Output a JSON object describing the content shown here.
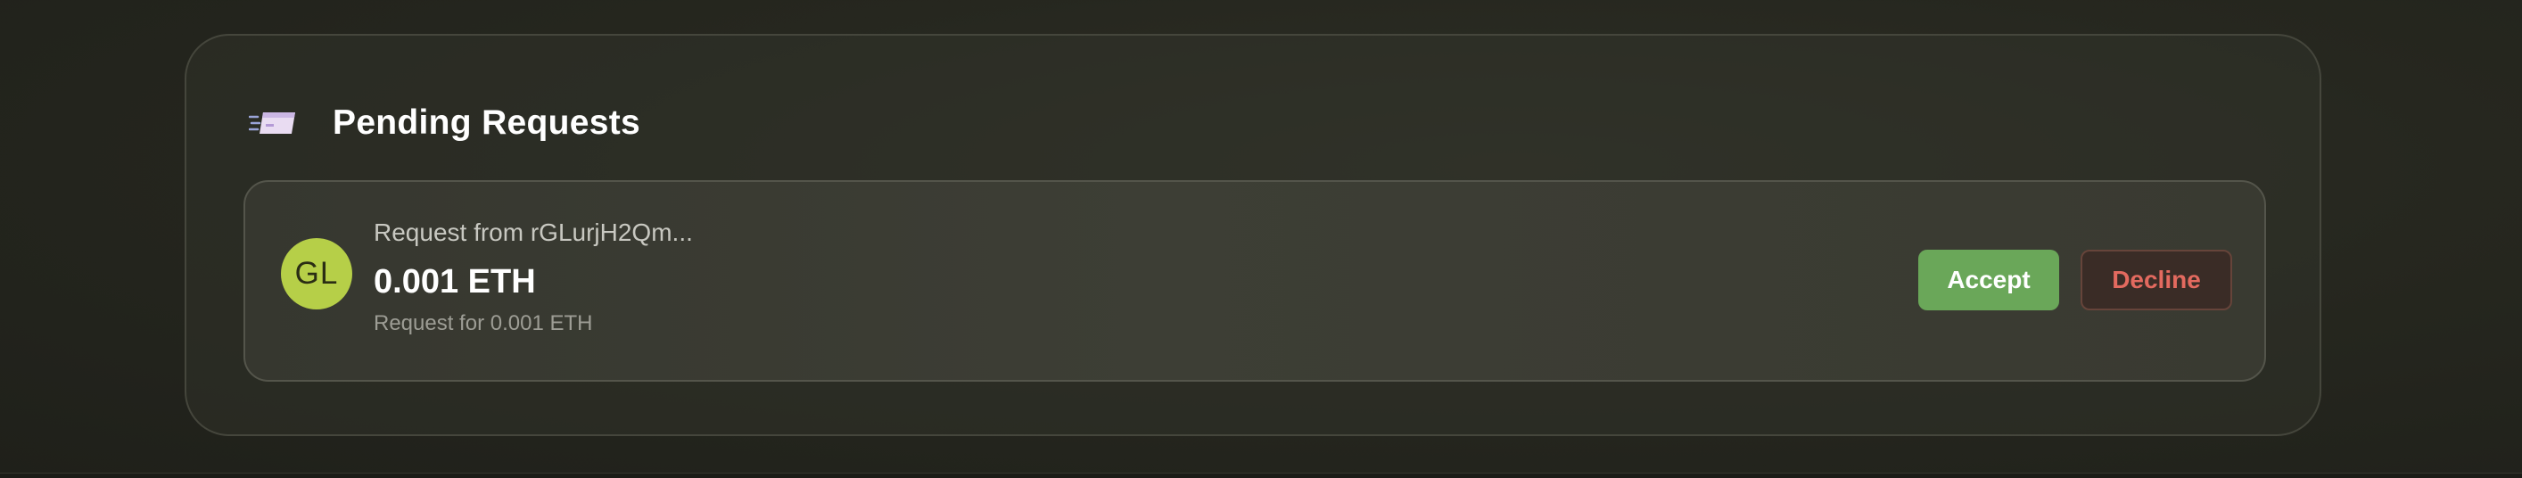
{
  "section": {
    "title": "Pending Requests",
    "icon": "payment-card-icon"
  },
  "requests": [
    {
      "avatar_initials": "GL",
      "avatar_color": "#b6cf48",
      "from_label": "Request from rGLurjH2Qm...",
      "amount": "0.001 ETH",
      "note": "Request for 0.001 ETH",
      "accept_label": "Accept",
      "decline_label": "Decline"
    }
  ],
  "colors": {
    "accept": "#6aa759",
    "decline_text": "#e36a5f",
    "background": "#26271f"
  }
}
